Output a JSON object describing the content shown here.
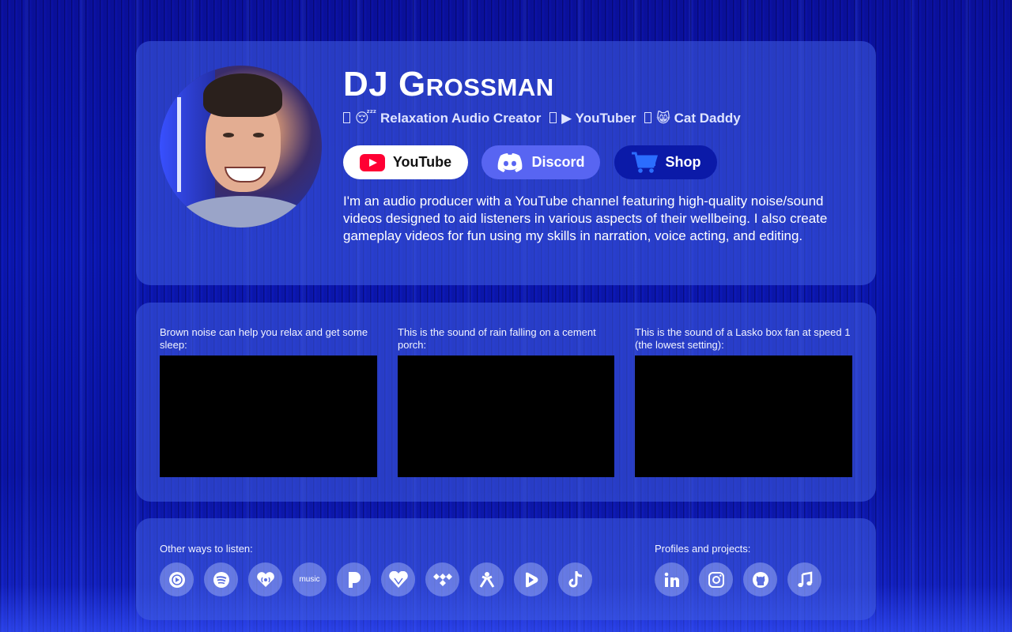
{
  "profile": {
    "name": "DJ Grossman",
    "tagline": {
      "item1": "😴 Relaxation Audio Creator",
      "item2": "▶ YouTuber",
      "item3": "😸 Cat Daddy"
    },
    "buttons": {
      "youtube": "YouTube",
      "discord": "Discord",
      "shop": "Shop"
    },
    "bio": "I'm an audio producer with a YouTube channel featuring high-quality noise/sound videos designed to aid listeners in various aspects of their wellbeing. I also create gameplay videos for fun using my skills in narration, voice acting, and editing."
  },
  "videos": [
    {
      "caption": "Brown noise can help you relax and get some sleep:"
    },
    {
      "caption": "This is the sound of rain falling on a cement porch:"
    },
    {
      "caption": "This is the sound of a Lasko box fan at speed 1 (the lowest setting):"
    }
  ],
  "listen": {
    "label": "Other ways to listen:",
    "icons": [
      "youtube-music-icon",
      "spotify-icon",
      "iheart-icon",
      "amazon-music-icon",
      "pandora-icon",
      "deezer-icon",
      "tidal-icon",
      "anghami-icon",
      "rumble-icon",
      "tiktok-icon"
    ],
    "amazon_text": "music"
  },
  "profiles": {
    "label": "Profiles and projects:",
    "icons": [
      "linkedin-icon",
      "instagram-icon",
      "github-icon",
      "music-note-icon"
    ]
  },
  "colors": {
    "card": "#415fe1",
    "discord": "#5865f2",
    "shop": "#0b1aa8",
    "youtube_red": "#ff0033"
  }
}
